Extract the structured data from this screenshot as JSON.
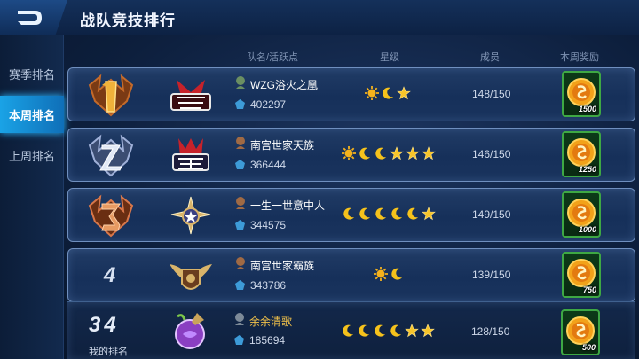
{
  "header": {
    "title": "战队竞技排行",
    "back_icon": "back-arrow-icon"
  },
  "sidebar": {
    "tabs": [
      {
        "label": "赛季排名",
        "active": false
      },
      {
        "label": "本周排名",
        "active": true
      },
      {
        "label": "上周排名",
        "active": false
      }
    ]
  },
  "columns": {
    "team": "队名/活跃点",
    "stars": "星级",
    "members": "成员",
    "reward": "本周奖励"
  },
  "rows": [
    {
      "rank": "1",
      "team_name": "WZG浴火之凰",
      "activity": "402297",
      "stars": [
        "sun",
        "moon",
        "star"
      ],
      "members": "148/150",
      "reward": "1500"
    },
    {
      "rank": "2",
      "team_name": "南宫世家天族",
      "activity": "366444",
      "stars": [
        "sun",
        "moon",
        "moon",
        "star",
        "star",
        "star"
      ],
      "members": "146/150",
      "reward": "1250"
    },
    {
      "rank": "3",
      "team_name": "一生一世意中人",
      "activity": "344575",
      "stars": [
        "moon",
        "moon",
        "moon",
        "moon",
        "moon",
        "star"
      ],
      "members": "149/150",
      "reward": "1000"
    },
    {
      "rank": "4",
      "team_name": "南宫世家霸族",
      "activity": "343786",
      "stars": [
        "sun",
        "moon"
      ],
      "members": "139/150",
      "reward": "750"
    }
  ],
  "my_team": {
    "rank": "34",
    "rank_label": "我的排名",
    "team_name": "余余清歌",
    "activity": "185694",
    "stars": [
      "moon",
      "moon",
      "moon",
      "moon",
      "star",
      "star"
    ],
    "members": "128/150",
    "reward": "500"
  },
  "colors": {
    "accent": "#1aa3e6",
    "gold": "#f2c24a",
    "reward_border": "#3ea844"
  }
}
